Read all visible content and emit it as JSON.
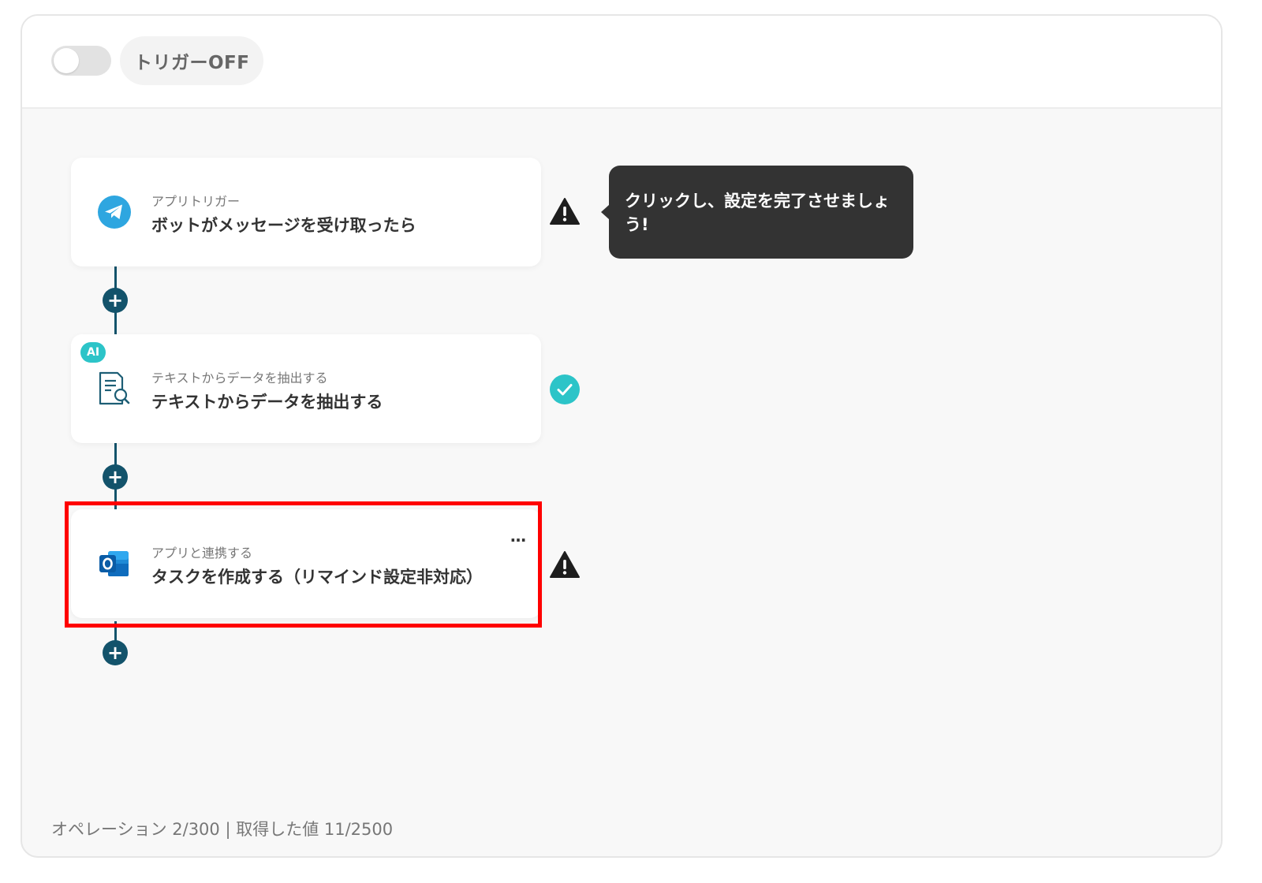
{
  "topbar": {
    "toggle_state": "off",
    "trigger_label": "トリガーOFF"
  },
  "tooltip": {
    "text": "クリックし、設定を完了させましょう!"
  },
  "steps": [
    {
      "subtitle": "アプリトリガー",
      "title": "ボットがメッセージを受け取ったら",
      "icon": "telegram-icon",
      "status": "warning"
    },
    {
      "badge": "AI",
      "subtitle": "テキストからデータを抽出する",
      "title": "テキストからデータを抽出する",
      "icon": "document-search-icon",
      "status": "complete"
    },
    {
      "subtitle": "アプリと連携する",
      "title": "タスクを作成する（リマインド設定非対応）",
      "icon": "outlook-icon",
      "status": "warning",
      "menu": "…"
    }
  ],
  "footer": {
    "stats": "オペレーション 2/300 | 取得した値 11/2500"
  },
  "colors": {
    "connector": "#13536b",
    "highlight": "#ff0000",
    "check": "#2cc4c8",
    "tooltip_bg": "#333333"
  }
}
